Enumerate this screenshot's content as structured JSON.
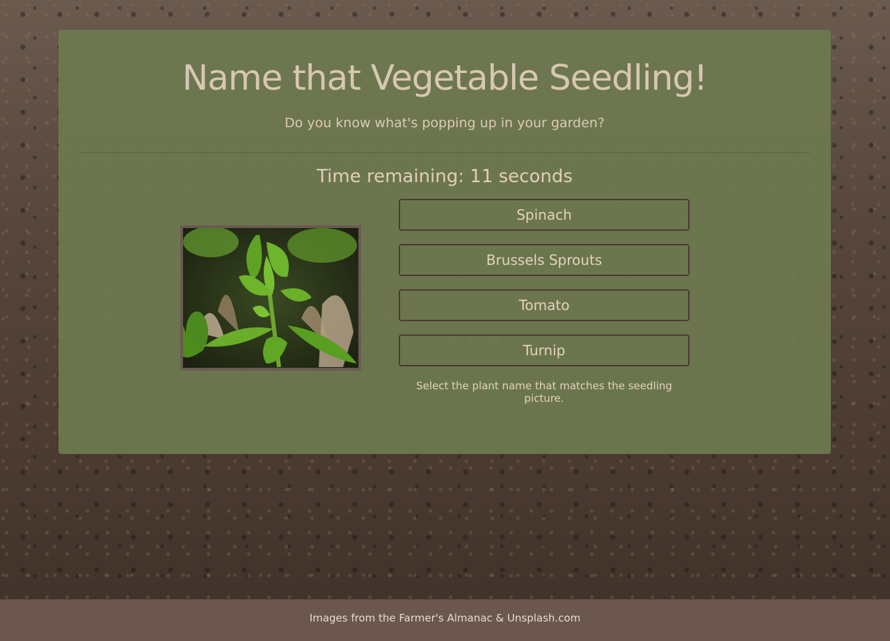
{
  "header": {
    "title": "Name that Vegetable Seedling!",
    "subtitle": "Do you know what's popping up in your garden?"
  },
  "game": {
    "timer_text": "Time remaining: 11 seconds",
    "image_icon": "seedling-photo",
    "answers": [
      "Spinach",
      "Brussels Sprouts",
      "Tomato",
      "Turnip"
    ],
    "instruction": "Select the plant name that matches the seedling picture."
  },
  "footer": {
    "credit": "Images from the Farmer's Almanac & Unsplash.com"
  },
  "colors": {
    "panel": "#6e7a50",
    "title_text": "#d8c7b2",
    "button_border": "#4a3b33",
    "footer_bg": "#6b5650"
  }
}
